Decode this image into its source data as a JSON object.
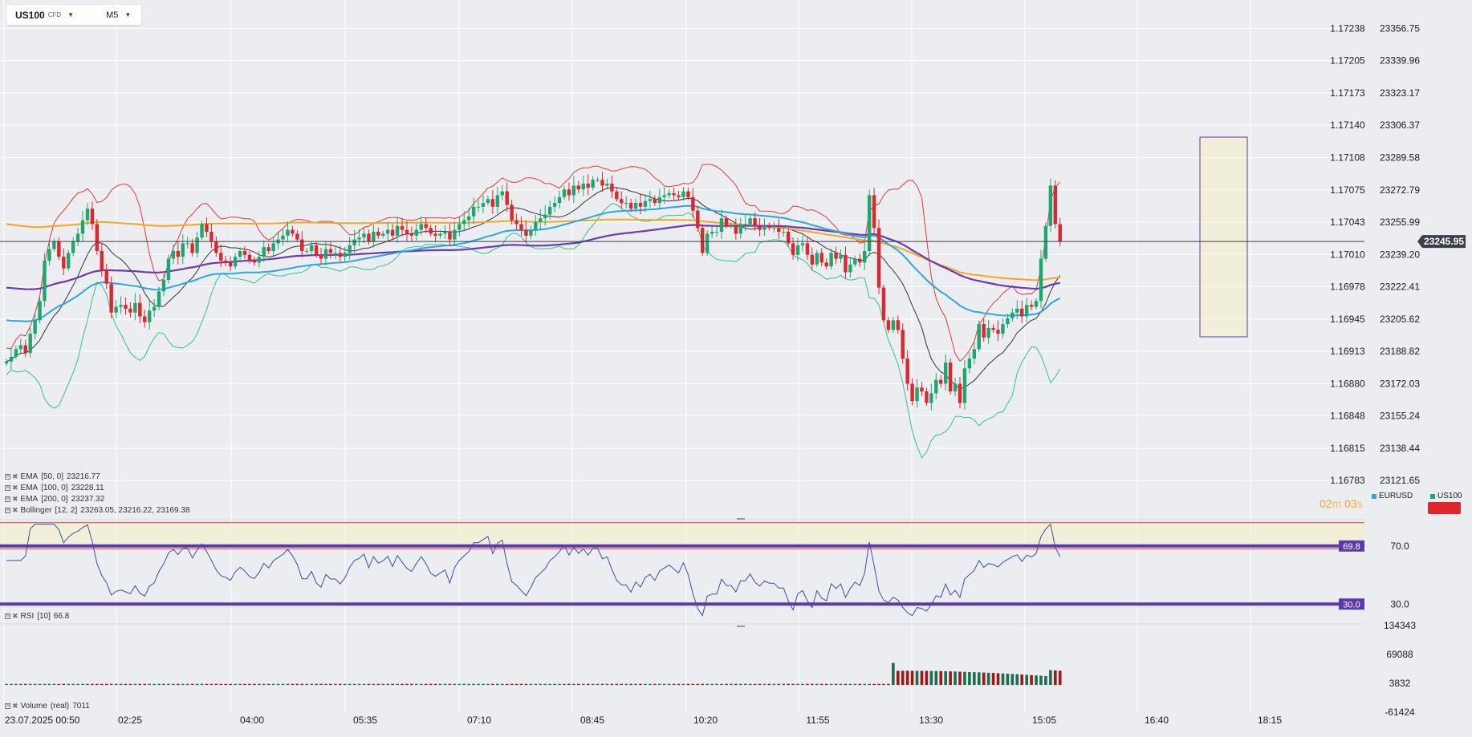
{
  "toolbar": {
    "symbol": "US100",
    "symbol_tag": "CFD",
    "timeframe": "M5"
  },
  "indicators": {
    "ema50": {
      "label": "EMA",
      "params": "[50, 0]",
      "value": "23216.77"
    },
    "ema100": {
      "label": "EMA",
      "params": "[100, 0]",
      "value": "23228.11"
    },
    "ema200": {
      "label": "EMA",
      "params": "[200, 0]",
      "value": "23237.32"
    },
    "bollinger": {
      "label": "Bollinger",
      "params": "[12, 2]",
      "values": "23263.05,  23216.22,  23169.38"
    },
    "rsi": {
      "label": "RSI",
      "params": "[10]",
      "value": "66.8"
    },
    "volume": {
      "label": "Volume",
      "params": "(real)",
      "value": "7011"
    }
  },
  "timer": {
    "minutes": "02",
    "minutes_unit": "m",
    "seconds": "03",
    "seconds_unit": "s"
  },
  "symbols": [
    {
      "name": "EURUSD",
      "color": "#29a8e0"
    },
    {
      "name": "US100",
      "color": "#1ea672"
    }
  ],
  "colors": {
    "bull": "#1ea672",
    "bear": "#e0252c",
    "ema50": "#29a8e0",
    "ema100": "#6b3ab3",
    "ema200": "#f5a623",
    "boll_upper": "#e53935",
    "boll_lower": "#2fc48d",
    "boll_mid": "#333333",
    "rsi_line": "#3a4fa8",
    "rsi_level": "#5b3ab0",
    "grid": "#ffffff",
    "price_tag": "#3a3f4b"
  },
  "chart_data": [
    {
      "type": "candlestick",
      "x_labels": [
        "23.07.2025  00:50",
        "02:25",
        "04:00",
        "05:35",
        "07:10",
        "08:45",
        "10:20",
        "11:55",
        "13:30",
        "15:05",
        "16:40",
        "18:15"
      ],
      "y_axis_left": {
        "ticks": [
          "1.17238",
          "1.17205",
          "1.17173",
          "1.17140",
          "1.17108",
          "1.17075",
          "1.17043",
          "1.17010",
          "1.16978",
          "1.16945",
          "1.16913",
          "1.16880",
          "1.16848",
          "1.16815",
          "1.16783"
        ]
      },
      "y_axis_right": {
        "ticks": [
          "23356.75",
          "23339.96",
          "23323.17",
          "23306.37",
          "23289.58",
          "23272.79",
          "23255.99",
          "23239.20",
          "23222.41",
          "23205.62",
          "23188.82",
          "23172.03",
          "23155.24",
          "23138.44",
          "23121.65"
        ],
        "ylim": [
          23118.0,
          23364.0
        ]
      },
      "current_price": "23245.95",
      "closes": [
        23183.5,
        23186,
        23190,
        23192,
        23188,
        23198,
        23205,
        23215,
        23236,
        23242,
        23246,
        23238,
        23232,
        23240,
        23246,
        23250,
        23257,
        23263,
        23255,
        23241,
        23231,
        23224,
        23209,
        23212,
        23213,
        23211,
        23209,
        23214,
        23207,
        23204,
        23210,
        23212,
        23220,
        23226,
        23237,
        23241,
        23238,
        23245,
        23245,
        23240,
        23248,
        23255,
        23251,
        23246,
        23240,
        23236,
        23235,
        23233,
        23238,
        23241,
        23239,
        23236,
        23235,
        23238,
        23243,
        23241,
        23245,
        23247,
        23249,
        23252,
        23250,
        23247,
        23241,
        23241,
        23244,
        23239,
        23237,
        23242,
        23240,
        23240,
        23238,
        23240,
        23244,
        23247,
        23248,
        23250,
        23246,
        23251,
        23249,
        23250,
        23252,
        23249,
        23254,
        23252,
        23250,
        23249,
        23252,
        23255,
        23253,
        23250,
        23249,
        23250,
        23251,
        23247,
        23252,
        23255,
        23257,
        23259,
        23264,
        23264,
        23266,
        23268,
        23264,
        23270,
        23272,
        23265,
        23257,
        23255,
        23252,
        23249,
        23252,
        23256,
        23258,
        23260,
        23264,
        23266,
        23269,
        23273,
        23270,
        23275,
        23273,
        23276,
        23274,
        23278,
        23278,
        23275,
        23276,
        23272,
        23268,
        23266,
        23266,
        23263,
        23266,
        23264,
        23267,
        23268,
        23266,
        23269,
        23270,
        23271,
        23270,
        23269,
        23272,
        23269,
        23262,
        23253,
        23240,
        23250,
        23251,
        23251,
        23258,
        23254,
        23254,
        23250,
        23255,
        23255,
        23258,
        23254,
        23252,
        23254,
        23253,
        23253,
        23251,
        23251,
        23245,
        23239,
        23244,
        23245,
        23239,
        23234,
        23240,
        23235,
        23233,
        23240,
        23237,
        23239,
        23230,
        23234,
        23237,
        23235,
        23241,
        23270,
        23253,
        23222,
        23205,
        23200,
        23205,
        23200,
        23185,
        23172,
        23163,
        23170,
        23168,
        23162,
        23167,
        23174,
        23172,
        23183,
        23168,
        23172,
        23162,
        23180,
        23185,
        23190,
        23203,
        23196,
        23201,
        23200,
        23198,
        23203,
        23206,
        23209,
        23211,
        23207,
        23213,
        23212,
        23215,
        23237,
        23254,
        23275,
        23255,
        23246
      ]
    },
    {
      "type": "line",
      "name": "RSI",
      "levels": [
        70.0,
        30.0
      ],
      "level_labels": [
        "69.8",
        "30.0"
      ],
      "ticks": [
        "70.0",
        "30.0"
      ],
      "ylim": [
        18,
        87
      ]
    },
    {
      "type": "bar",
      "name": "Volume",
      "ticks": [
        "134343",
        "69088",
        "3832",
        "-61424"
      ],
      "ylim": [
        -61424,
        134343
      ]
    }
  ]
}
